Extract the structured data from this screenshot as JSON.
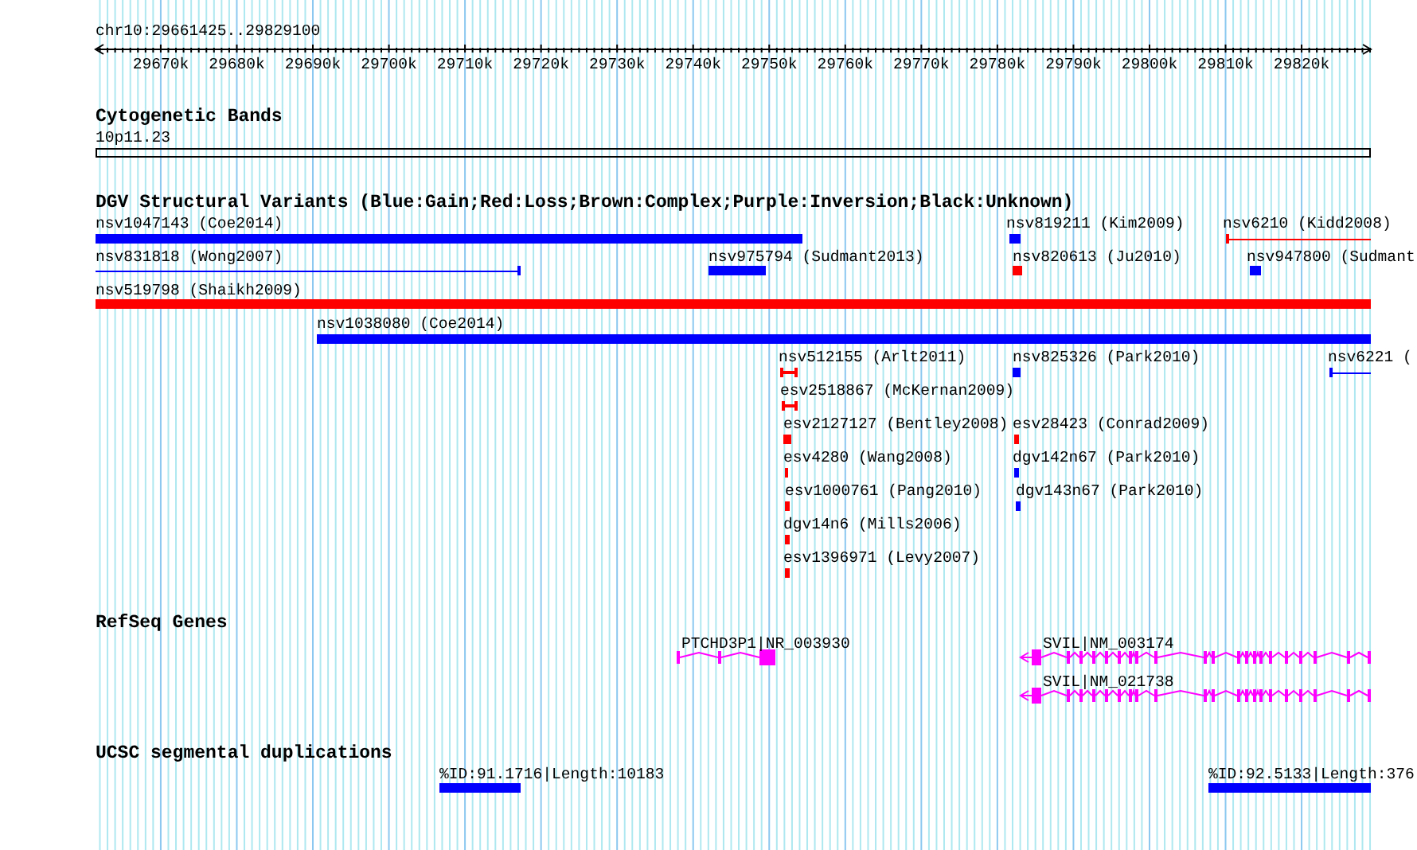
{
  "ruler": {
    "location": "chr10:29661425..29829100",
    "ticks": [
      "29670k",
      "29680k",
      "29690k",
      "29700k",
      "29710k",
      "29720k",
      "29730k",
      "29740k",
      "29750k",
      "29760k",
      "29770k",
      "29780k",
      "29790k",
      "29800k",
      "29810k",
      "29820k"
    ]
  },
  "tracks": [
    {
      "kind": "bands",
      "title": "Cytogenetic Bands",
      "features": [
        {
          "label": "10p11.23"
        }
      ]
    },
    {
      "kind": "variants",
      "title": "DGV Structural Variants (Blue:Gain;Red:Loss;Brown:Complex;Purple:Inversion;Black:Unknown)",
      "features": [
        {
          "label": "nsv1047143 (Coe2014)",
          "color": "#0000ff",
          "kind": "bar"
        },
        {
          "label": "nsv819211 (Kim2009)",
          "color": "#0000ff",
          "kind": "bar"
        },
        {
          "label": "nsv6210 (Kidd2008)",
          "color": "#ff0000",
          "kind": "line"
        },
        {
          "label": "nsv831818 (Wong2007)",
          "color": "#0000ff",
          "kind": "line"
        },
        {
          "label": "nsv975794 (Sudmant2013)",
          "color": "#0000ff",
          "kind": "bar"
        },
        {
          "label": "nsv820613 (Ju2010)",
          "color": "#ff0000",
          "kind": "bar"
        },
        {
          "label": "nsv947800 (Sudmant",
          "color": "#0000ff",
          "kind": "bar"
        },
        {
          "label": "nsv519798 (Shaikh2009)",
          "color": "#ff0000",
          "kind": "bar"
        },
        {
          "label": "nsv1038080 (Coe2014)",
          "color": "#0000ff",
          "kind": "bar"
        },
        {
          "label": "nsv512155 (Arlt2011)",
          "color": "#ff0000",
          "kind": "span"
        },
        {
          "label": "nsv825326 (Park2010)",
          "color": "#0000ff",
          "kind": "bar"
        },
        {
          "label": "nsv6221 (",
          "color": "#0000ff",
          "kind": "line"
        },
        {
          "label": "esv2518867 (McKernan2009)",
          "color": "#ff0000",
          "kind": "span"
        },
        {
          "label": "esv2127127 (Bentley2008)",
          "color": "#ff0000",
          "kind": "bar"
        },
        {
          "label": "esv28423 (Conrad2009)",
          "color": "#ff0000",
          "kind": "bar"
        },
        {
          "label": "esv4280 (Wang2008)",
          "color": "#ff0000",
          "kind": "span"
        },
        {
          "label": "dgv142n67 (Park2010)",
          "color": "#0000ff",
          "kind": "bar"
        },
        {
          "label": "esv1000761 (Pang2010)",
          "color": "#ff0000",
          "kind": "bar"
        },
        {
          "label": "dgv143n67 (Park2010)",
          "color": "#0000ff",
          "kind": "bar"
        },
        {
          "label": "dgv14n6 (Mills2006)",
          "color": "#ff0000",
          "kind": "bar"
        },
        {
          "label": "esv1396971 (Levy2007)",
          "color": "#ff0000",
          "kind": "bar"
        }
      ]
    },
    {
      "kind": "genes",
      "title": "RefSeq Genes",
      "features": [
        {
          "label": "PTCHD3P1|NR_003930",
          "arrow": false
        },
        {
          "label": "SVIL|NM_003174",
          "arrow": true
        },
        {
          "label": "SVIL|NM_021738",
          "arrow": true
        }
      ]
    },
    {
      "kind": "dups",
      "title": "UCSC segmental duplications",
      "features": [
        {
          "label": "%ID:91.1716|Length:10183"
        },
        {
          "label": "%ID:92.5133|Length:376"
        }
      ]
    }
  ]
}
